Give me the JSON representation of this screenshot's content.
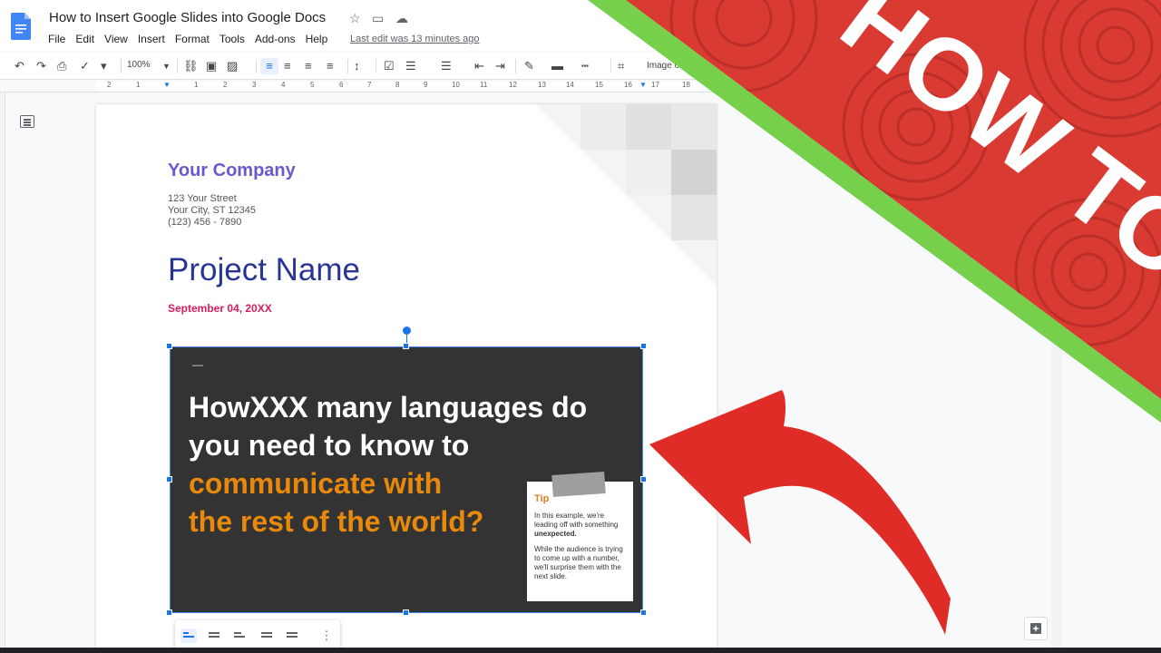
{
  "document": {
    "title": "How to Insert Google Slides into Google Docs",
    "last_edit": "Last edit was 13 minutes ago"
  },
  "menubar": [
    "File",
    "Edit",
    "View",
    "Insert",
    "Format",
    "Tools",
    "Add-ons",
    "Help"
  ],
  "toolbar": {
    "zoom": "100%",
    "image_options": "Image o"
  },
  "ruler": [
    "2",
    "1",
    "1",
    "2",
    "3",
    "4",
    "5",
    "6",
    "7",
    "8",
    "9",
    "10",
    "11",
    "12",
    "13",
    "14",
    "15",
    "16",
    "17",
    "18"
  ],
  "page": {
    "company": "Your Company",
    "address": [
      "123 Your Street",
      "Your City, ST 12345",
      "(123) 456 - 7890"
    ],
    "project": "Project Name",
    "date": "September 04, 20XX"
  },
  "slide": {
    "dash": "—",
    "lines": [
      {
        "text": "HowXXX many languages do",
        "color": "#ffffff"
      },
      {
        "text": "you need to know to",
        "color": "#ffffff"
      },
      {
        "text": "communicate with",
        "color": "#e8890c"
      },
      {
        "text": "the rest of the world?",
        "color": "#e8890c"
      }
    ],
    "tip": {
      "label": "Tip",
      "para1_a": "In this example, we're leading off with something ",
      "para1_b": "unexpected.",
      "para2": "While the audience is trying to come up with a number, we'll surprise them with the next slide."
    }
  },
  "banner": {
    "text": "HOW TO",
    "background": "#d93a32",
    "stripe": "#76d04b"
  },
  "colors": {
    "accent": "#1a73e8",
    "arrow": "#e02c26"
  }
}
